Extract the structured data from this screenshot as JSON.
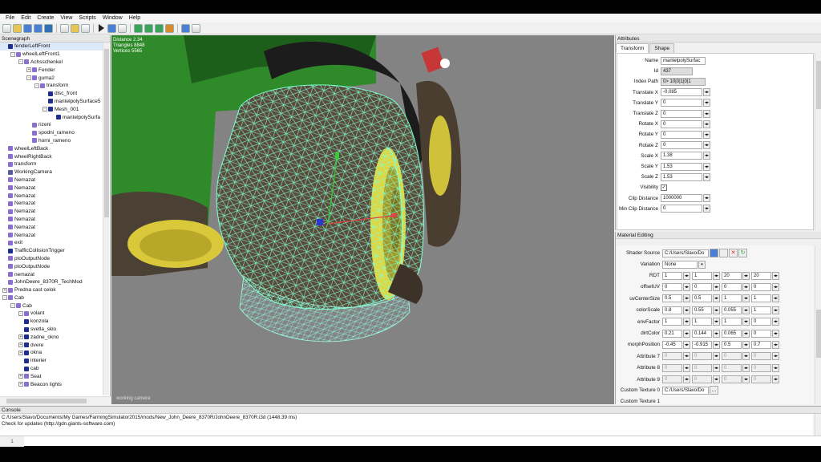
{
  "menu": [
    "File",
    "Edit",
    "Create",
    "View",
    "Scripts",
    "Window",
    "Help"
  ],
  "scenegraph": {
    "title": "Scenegraph",
    "nodes": [
      {
        "label": "fenderLeftFront",
        "depth": 0,
        "exp": "",
        "icon": "shape"
      },
      {
        "label": "wheelLeftFront1",
        "depth": 1,
        "exp": "-",
        "icon": "transform"
      },
      {
        "label": "Achsschenkel",
        "depth": 2,
        "exp": "-",
        "icon": "transform"
      },
      {
        "label": "Fender",
        "depth": 3,
        "exp": "+",
        "icon": "transform"
      },
      {
        "label": "guma2",
        "depth": 3,
        "exp": "-",
        "icon": "transform"
      },
      {
        "label": "transform",
        "depth": 4,
        "exp": "-",
        "icon": "transform"
      },
      {
        "label": "disc_front",
        "depth": 5,
        "exp": "",
        "icon": "shape"
      },
      {
        "label": "mantelpolySurface5",
        "depth": 5,
        "exp": "",
        "icon": "shape"
      },
      {
        "label": "Mesh_001",
        "depth": 5,
        "exp": "-",
        "icon": "shape"
      },
      {
        "label": "mantelpolySurfa",
        "depth": 6,
        "exp": "",
        "icon": "shape"
      },
      {
        "label": "rizeni",
        "depth": 3,
        "exp": "",
        "icon": "transform"
      },
      {
        "label": "spodni_rameno",
        "depth": 3,
        "exp": "",
        "icon": "transform"
      },
      {
        "label": "horni_rameno",
        "depth": 3,
        "exp": "",
        "icon": "transform"
      },
      {
        "label": "wheelLeftBack",
        "depth": 0,
        "exp": "",
        "icon": "transform"
      },
      {
        "label": "wheelRightBack",
        "depth": 0,
        "exp": "",
        "icon": "transform"
      },
      {
        "label": "transform",
        "depth": 0,
        "exp": "",
        "icon": "transform"
      },
      {
        "label": "WorkingCamera",
        "depth": 0,
        "exp": "",
        "icon": "camera"
      },
      {
        "label": "Nemazat",
        "depth": 0,
        "exp": "",
        "icon": "transform"
      },
      {
        "label": "Nemazat",
        "depth": 0,
        "exp": "",
        "icon": "transform"
      },
      {
        "label": "Nemazat",
        "depth": 0,
        "exp": "",
        "icon": "transform"
      },
      {
        "label": "Nemazat",
        "depth": 0,
        "exp": "",
        "icon": "transform"
      },
      {
        "label": "Nemazat",
        "depth": 0,
        "exp": "",
        "icon": "transform"
      },
      {
        "label": "Nemazat",
        "depth": 0,
        "exp": "",
        "icon": "transform"
      },
      {
        "label": "Nemazat",
        "depth": 0,
        "exp": "",
        "icon": "transform"
      },
      {
        "label": "Nemazat",
        "depth": 0,
        "exp": "",
        "icon": "transform"
      },
      {
        "label": "exit",
        "depth": 0,
        "exp": "",
        "icon": "transform"
      },
      {
        "label": "TrafficCollisionTrigger",
        "depth": 0,
        "exp": "",
        "icon": "shape"
      },
      {
        "label": "ptoOutputNode",
        "depth": 0,
        "exp": "",
        "icon": "transform"
      },
      {
        "label": "ptoOutputNode",
        "depth": 0,
        "exp": "",
        "icon": "transform"
      },
      {
        "label": "nemazat",
        "depth": 0,
        "exp": "",
        "icon": "transform"
      },
      {
        "label": "JohnDeere_8370R_TechMod",
        "depth": 0,
        "exp": "",
        "icon": "transform"
      },
      {
        "label": "Predna cast celok",
        "depth": 0,
        "exp": "+",
        "icon": "transform"
      },
      {
        "label": "Cab",
        "depth": 0,
        "exp": "-",
        "icon": "transform"
      },
      {
        "label": "Cab",
        "depth": 1,
        "exp": "-",
        "icon": "transform"
      },
      {
        "label": "volant",
        "depth": 2,
        "exp": "-",
        "icon": "transform"
      },
      {
        "label": "konzola",
        "depth": 2,
        "exp": "",
        "icon": "shape"
      },
      {
        "label": "svetla_sklo",
        "depth": 2,
        "exp": "",
        "icon": "shape"
      },
      {
        "label": "zadne_okno",
        "depth": 2,
        "exp": "+",
        "icon": "shape"
      },
      {
        "label": "dvere",
        "depth": 2,
        "exp": "+",
        "icon": "shape"
      },
      {
        "label": "okna",
        "depth": 2,
        "exp": "+",
        "icon": "shape"
      },
      {
        "label": "interier",
        "depth": 2,
        "exp": "",
        "icon": "shape"
      },
      {
        "label": "cab",
        "depth": 2,
        "exp": "",
        "icon": "shape"
      },
      {
        "label": "Seat",
        "depth": 2,
        "exp": "+",
        "icon": "transform"
      },
      {
        "label": "Beacon lights",
        "depth": 2,
        "exp": "+",
        "icon": "transform"
      }
    ]
  },
  "viewport": {
    "stats": [
      "Distance 2.34",
      "Triangles 8848",
      "Vertices 5565"
    ],
    "camera_label": "working camera"
  },
  "attributes": {
    "title": "Attributes",
    "tabs": [
      "Transform",
      "Shape"
    ],
    "rows": [
      {
        "label": "Name",
        "value": "mantelpolySurfac",
        "type": "wide"
      },
      {
        "label": "Id",
        "value": "437",
        "type": "ro-short"
      },
      {
        "label": "Index Path",
        "value": "0> 10|0|1|0|1",
        "type": "ro"
      },
      {
        "label": "Translate X",
        "value": "-0.085",
        "type": "num"
      },
      {
        "label": "Translate Y",
        "value": "0",
        "type": "num"
      },
      {
        "label": "Translate Z",
        "value": "0",
        "type": "num"
      },
      {
        "label": "Rotate X",
        "value": "0",
        "type": "num"
      },
      {
        "label": "Rotate Y",
        "value": "0",
        "type": "num"
      },
      {
        "label": "Rotate Z",
        "value": "0",
        "type": "num"
      },
      {
        "label": "Scale X",
        "value": "1.38",
        "type": "num"
      },
      {
        "label": "Scale Y",
        "value": "1.53",
        "type": "num"
      },
      {
        "label": "Scale Z",
        "value": "1.53",
        "type": "num"
      },
      {
        "label": "Visibility",
        "value": "✓",
        "type": "check"
      },
      {
        "label": "Clip Distance",
        "value": "1000000",
        "type": "num"
      },
      {
        "label": "Min Clip Distance",
        "value": "0",
        "type": "num"
      }
    ]
  },
  "material": {
    "title": "Material Editing",
    "shader_source": {
      "label": "Shader Source",
      "value": "C:/Users/Slavo/Do"
    },
    "variation": {
      "label": "Variation",
      "value": "None"
    },
    "params": [
      {
        "label": "RDT",
        "values": [
          "1",
          "1",
          "20",
          "20"
        ],
        "disabled": false
      },
      {
        "label": "offsetUV",
        "values": [
          "0",
          "0",
          "0",
          "0"
        ],
        "disabled": false
      },
      {
        "label": "uvCenterSize",
        "values": [
          "0.5",
          "0.5",
          "1",
          "1"
        ],
        "disabled": false
      },
      {
        "label": "colorScale",
        "values": [
          "0.8",
          "0.55",
          "0.055",
          "1"
        ],
        "disabled": false
      },
      {
        "label": "envFactor",
        "values": [
          "1",
          "1",
          "1",
          "0"
        ],
        "disabled": false
      },
      {
        "label": "dirtColor",
        "values": [
          "0.21",
          "0.144",
          "0.065",
          "0"
        ],
        "disabled": false
      },
      {
        "label": "morphPosition",
        "values": [
          "-0.45",
          "-0.915",
          "0.5",
          "0.7"
        ],
        "disabled": false
      },
      {
        "label": "Attribute 7",
        "values": [
          "0",
          "0",
          "0",
          "0"
        ],
        "disabled": true
      },
      {
        "label": "Attribute 8",
        "values": [
          "0",
          "0",
          "0",
          "0"
        ],
        "disabled": true
      },
      {
        "label": "Attribute 9",
        "values": [
          "0",
          "0",
          "0",
          "0"
        ],
        "disabled": true
      }
    ],
    "custom_texture_0": {
      "label": "Custom Texture 0",
      "value": "C:/Users/Slavo/Do",
      "btn": "..."
    },
    "custom_texture_1": {
      "label": "Custom Texture 1"
    }
  },
  "console": {
    "title": "Console",
    "lines": [
      "C:/Users/Slavo/Documents/My Games/FarmingSimulator2015/mods/New_John_Deere_8370R/JohnDeere_8370R.i3d (1448.39 ms)",
      "Check for updates (http://gdn.giants-software.com)"
    ],
    "line_number": "1"
  },
  "colors": {
    "tractor_green": "#2f8a2a",
    "rim_yellow": "#e3d53c",
    "wireframe": "#7fffd4",
    "viewport_bg": "#838384"
  }
}
